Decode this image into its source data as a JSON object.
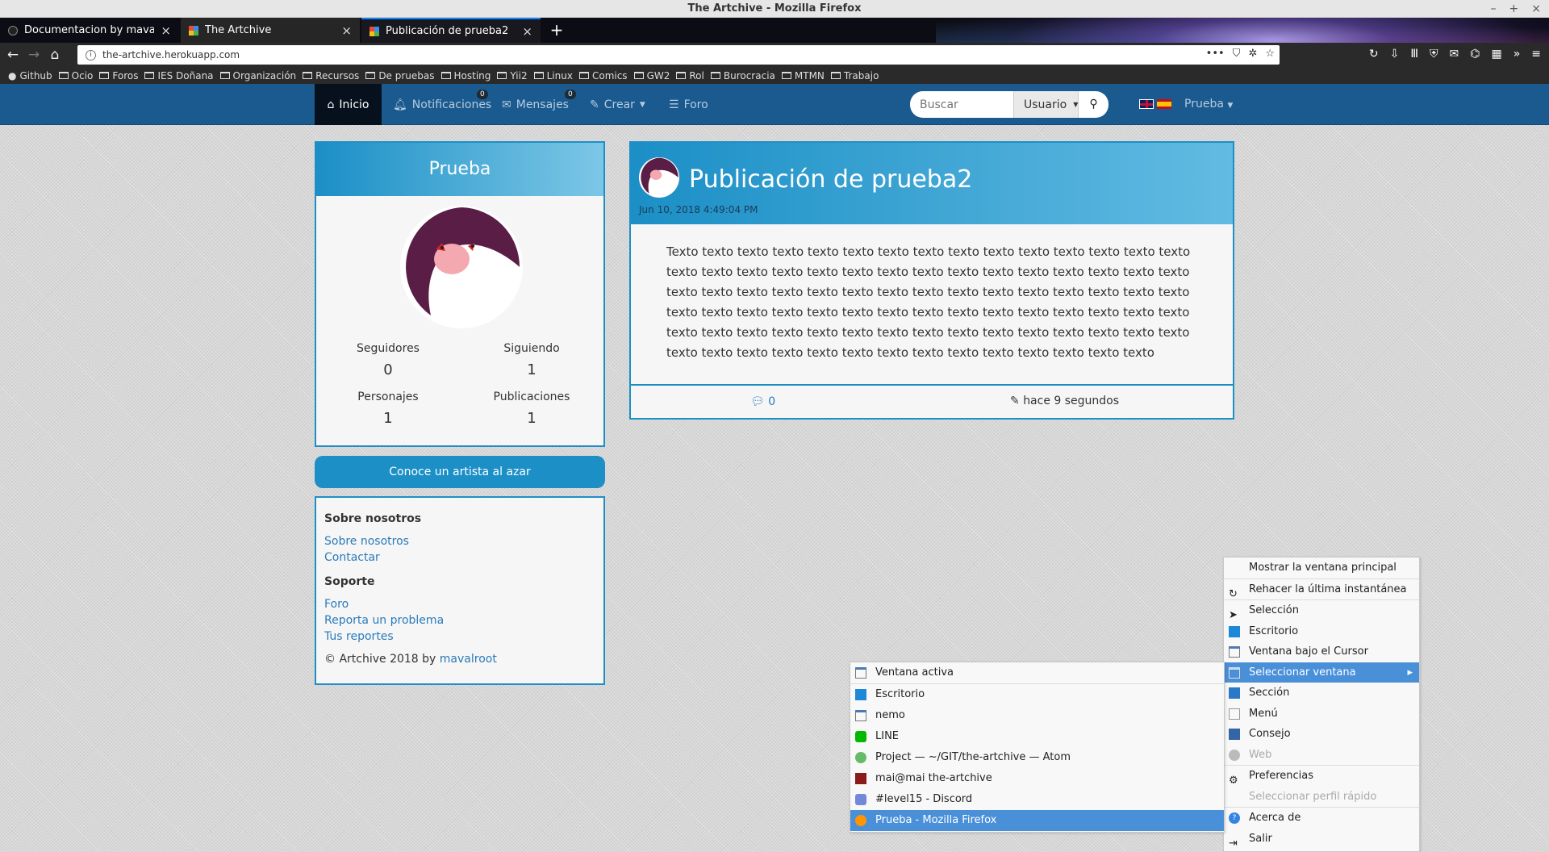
{
  "window": {
    "title": "The Artchive - Mozilla Firefox"
  },
  "tabs": [
    {
      "label": "Documentacion by mavalroot"
    },
    {
      "label": "The Artchive"
    },
    {
      "label": "Publicación de prueba2"
    }
  ],
  "address": {
    "url": "the-artchive.herokuapp.com"
  },
  "bookmarks": [
    "Github",
    "Ocio",
    "Foros",
    "IES Doñana",
    "Organización",
    "Recursos",
    "De pruebas",
    "Hosting",
    "Yii2",
    "Linux",
    "Comics",
    "GW2",
    "Rol",
    "Burocracia",
    "MTMN",
    "Trabajo"
  ],
  "nav": {
    "inicio": "Inicio",
    "notificaciones": "Notificaciones",
    "notif_count": "0",
    "mensajes": "Mensajes",
    "msg_count": "0",
    "crear": "Crear",
    "foro": "Foro",
    "search_placeholder": "Buscar",
    "search_scope": "Usuario",
    "user": "Prueba"
  },
  "profile": {
    "name": "Prueba",
    "seguidores_label": "Seguidores",
    "seguidores": "0",
    "siguiendo_label": "Siguiendo",
    "siguiendo": "1",
    "personajes_label": "Personajes",
    "personajes": "1",
    "publicaciones_label": "Publicaciones",
    "publicaciones": "1"
  },
  "random_artist": "Conoce un artista al azar",
  "about": {
    "heading1": "Sobre nosotros",
    "link_about": "Sobre nosotros",
    "link_contact": "Contactar",
    "heading2": "Soporte",
    "link_foro": "Foro",
    "link_report": "Reporta un problema",
    "link_reports": "Tus reportes",
    "copyright": "© Artchive 2018 by",
    "author": "mavalroot"
  },
  "post": {
    "title": "Publicación de prueba2",
    "date": "Jun 10, 2018 4:49:04 PM",
    "body": "Texto texto texto texto texto texto texto texto texto texto texto texto texto texto texto texto texto texto texto texto texto texto texto texto texto texto texto texto texto texto texto texto texto texto texto texto texto texto texto texto texto texto texto texto texto texto texto texto texto texto texto texto texto texto texto texto texto texto texto texto texto texto texto texto texto texto texto texto texto texto texto texto texto texto texto texto texto texto texto texto texto texto texto texto texto texto texto texto texto",
    "comments": "0",
    "time": "hace 9 segundos"
  },
  "main_menu": [
    "Mostrar la ventana principal",
    "Rehacer la última instantánea",
    "Selección",
    "Escritorio",
    "Ventana bajo el Cursor",
    "Seleccionar ventana",
    "Sección",
    "Menú",
    "Consejo",
    "Web",
    "Preferencias",
    "Seleccionar perfil rápido",
    "Acerca de",
    "Salir"
  ],
  "sub_menu": [
    "Ventana activa",
    "Escritorio",
    "nemo",
    "LINE",
    "Project — ~/GIT/the-artchive — Atom",
    "mai@mai the-artchive",
    "#level15 - Discord",
    "Prueba - Mozilla Firefox"
  ],
  "colors": {
    "site_nav": "#1a5a8e",
    "accent": "#1b8fc6",
    "menu_highlight": "#4a90d9"
  }
}
